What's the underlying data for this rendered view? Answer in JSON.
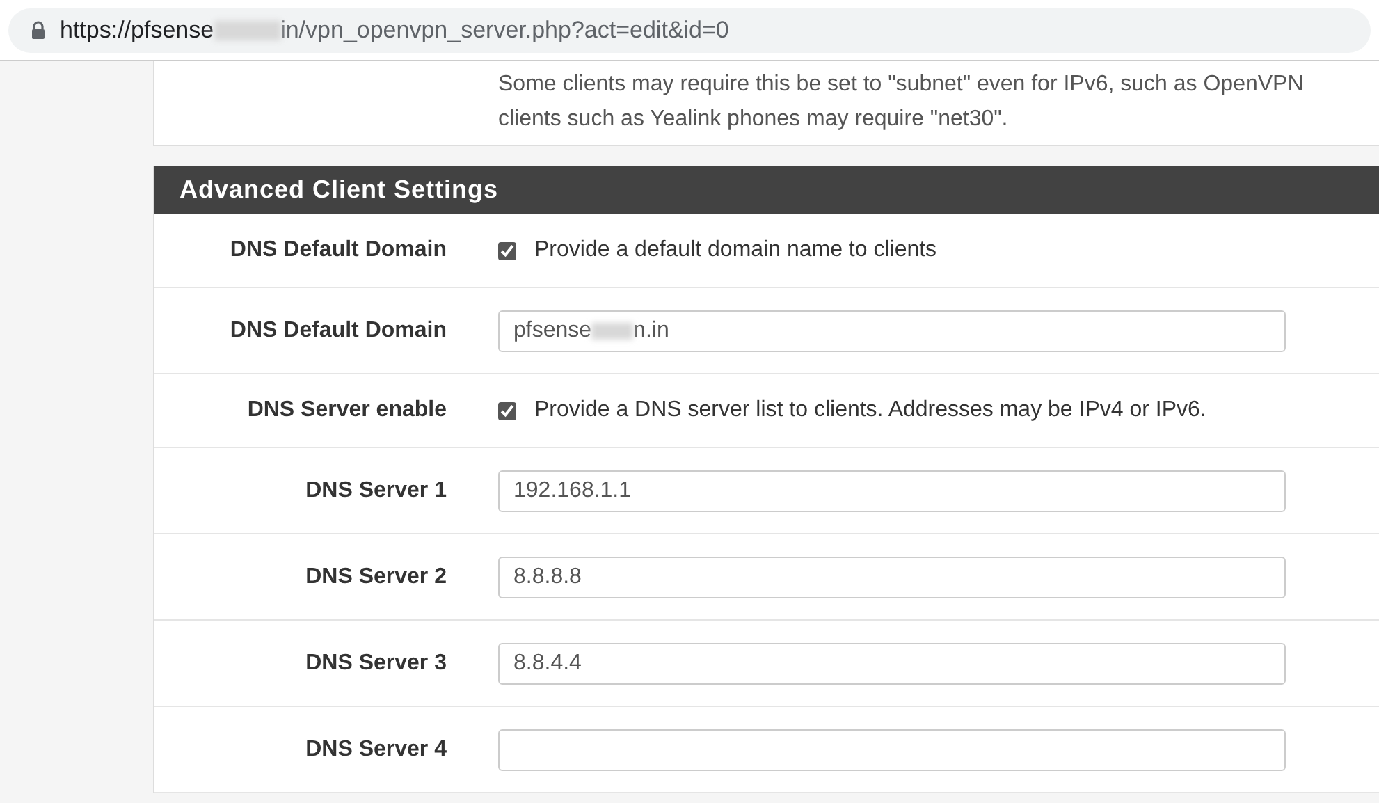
{
  "address_bar": {
    "url_start": "https://pfsense",
    "url_end": "in/vpn_openvpn_server.php?act=edit&id=0"
  },
  "help_text_lines": [
    "Some clients may require this be set to \"subnet\" even for IPv6, such as OpenVPN",
    "clients such as Yealink phones may require \"net30\"."
  ],
  "section": {
    "title": "Advanced Client Settings",
    "rows": [
      {
        "kind": "checkbox",
        "label": "DNS Default Domain",
        "checked": true,
        "text": "Provide a default domain name to clients"
      },
      {
        "kind": "field",
        "label": "DNS Default Domain",
        "value_start": "pfsense",
        "value_end": "n.in",
        "redacted": true
      },
      {
        "kind": "checkbox",
        "label": "DNS Server enable",
        "checked": true,
        "text": "Provide a DNS server list to clients. Addresses may be IPv4 or IPv6."
      },
      {
        "kind": "field",
        "label": "DNS Server 1",
        "value_start": "192.168.1.1",
        "redacted": false
      },
      {
        "kind": "field",
        "label": "DNS Server 2",
        "value_start": "8.8.8.8",
        "redacted": false
      },
      {
        "kind": "field",
        "label": "DNS Server 3",
        "value_start": "8.8.4.4",
        "redacted": false
      },
      {
        "kind": "field",
        "label": "DNS Server 4",
        "redacted": false
      }
    ]
  }
}
